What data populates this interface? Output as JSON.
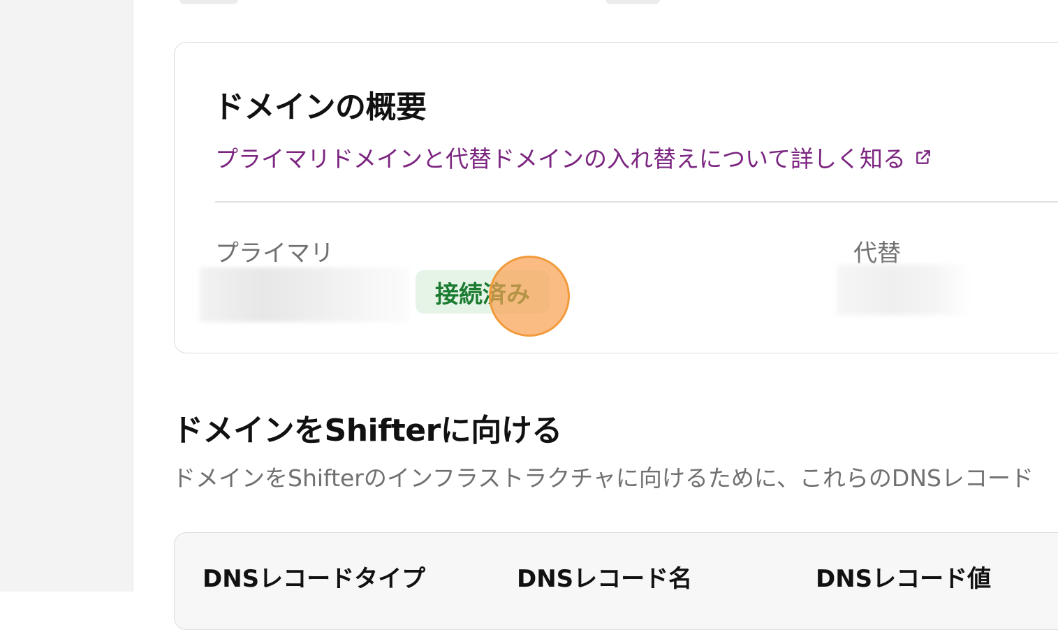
{
  "overview": {
    "title": "ドメインの概要",
    "learn_more_link": "プライマリドメインと代替ドメインの入れ替えについて詳しく知る",
    "primary_label": "プライマリ",
    "alternate_label": "代替",
    "status_badge": "接続済み"
  },
  "dns_section": {
    "title": "ドメインをShifterに向ける",
    "description": "ドメインをShifterのインフラストラクチャに向けるために、これらのDNSレコード",
    "table": {
      "columns": [
        "DNSレコードタイプ",
        "DNSレコード名",
        "DNSレコード値"
      ]
    }
  },
  "colors": {
    "link": "#7b2580",
    "badge_bg": "#e5f4e6",
    "badge_text": "#1a7a2f",
    "click_marker": "#f29a3c"
  }
}
